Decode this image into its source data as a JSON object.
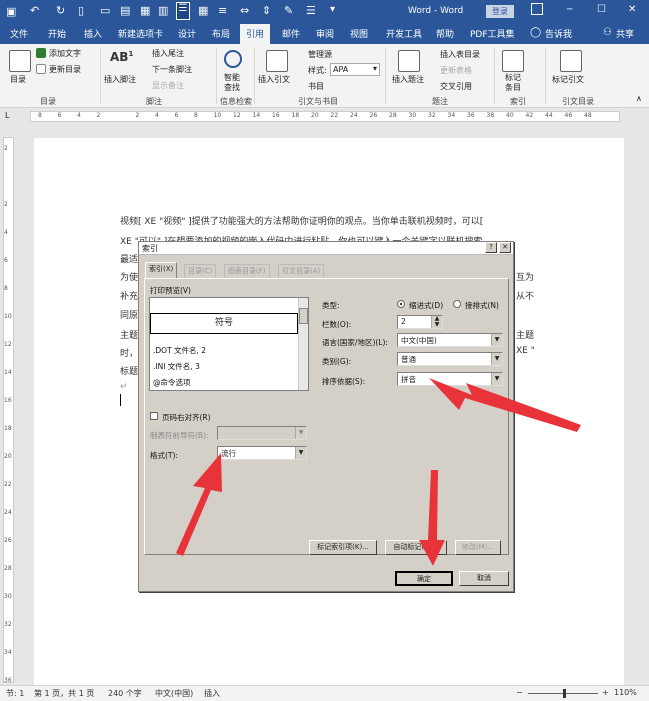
{
  "titlebar": {
    "title": "Word - Word",
    "login": "登录",
    "controls": [
      "─",
      "☐",
      "✕"
    ]
  },
  "tabs": [
    "文件",
    "开始",
    "插入",
    "新建选项卡",
    "设计",
    "布局",
    "引用",
    "邮件",
    "审阅",
    "视图",
    "开发工具",
    "帮助",
    "PDF工具集"
  ],
  "tabs_active": "引用",
  "tell_me": "告诉我",
  "share": "共享",
  "ribbon": {
    "toc_btn": "目录",
    "add_text": "添加文字",
    "update_toc": "更新目录",
    "insert_footnote": "插入脚注",
    "insert_endnote": "插入尾注",
    "next_footnote": "下一条脚注",
    "show_notes": "显示备注",
    "smart_lookup_1": "智能",
    "smart_lookup_2": "查找",
    "insert_citation": "插入引文",
    "manage_sources": "管理源",
    "style_label": "样式:",
    "style_value": "APA",
    "bibliography": "书目",
    "insert_caption": "插入题注",
    "insert_table_figures": "插入表目录",
    "update_table": "更新表格",
    "cross_ref": "交叉引用",
    "mark_entry_1": "标记",
    "mark_entry_2": "条目",
    "mark_citation": "标记引文",
    "groups": [
      "目录",
      "脚注",
      "信息检索",
      "引文与书目",
      "题注",
      "索引",
      "引文目录"
    ]
  },
  "document": {
    "line1": "视频[ XE \"视频\" ]提供了功能强大的方法帮助你证明你的观点。当你单击联机视频时，可以[",
    "line2": "XE \"可以\" ]在想要添加的视频的嵌入代码中进行粘贴。你也可以键入一个关键字以联机搜索",
    "line3": "最适",
    "line4_left": "为使",
    "line4_right": "互为",
    "line5_left": "补充",
    "line5_right": "从不",
    "line6_left": "同原",
    "line7_left": "主题",
    "line7_right": "主题",
    "line8_left": "时，",
    "line8_right": "XE \"",
    "line9_left": "标题",
    "mark": "↵"
  },
  "dialog": {
    "title": "索引",
    "help": "?",
    "close": "✕",
    "tabs": [
      "索引(X)",
      "目录(C)",
      "图表目录(F)",
      "引文目录(A)"
    ],
    "print_preview": "打印预览(V)",
    "preview_heading": "符号",
    "preview_lines": [
      ".DOT 文件名, 2",
      ".INI 文件名, 3",
      "@命令选项"
    ],
    "type_label": "类型:",
    "radio_indented": "缩进式(D)",
    "radio_runin": "接排式(N)",
    "columns_label": "栏数(O):",
    "columns_value": "2",
    "language_label": "语言(国家/地区)(L):",
    "language_value": "中文(中国)",
    "category_label": "类别(G):",
    "category_value": "普通",
    "sort_label": "排序依据(S):",
    "sort_value": "拼音",
    "right_align": "页码右对齐(R)",
    "tab_leader": "制表符前导符(B):",
    "format_label": "格式(T):",
    "format_value": "流行",
    "mark_entry_btn": "标记索引项(K)...",
    "automark_btn": "自动标记(U)...",
    "modify_btn": "修改(M)...",
    "ok_btn": "确定",
    "cancel_btn": "取消"
  },
  "status": {
    "page": "节: 1",
    "pages": "第 1 页，共 1 页",
    "words": "240 个字",
    "lang": "中文(中国)",
    "insert": "插入",
    "zoom": "110%"
  },
  "ruler_numbers": [
    "8",
    "6",
    "4",
    "2",
    "",
    "2",
    "4",
    "6",
    "8",
    "10",
    "12",
    "14",
    "16",
    "18",
    "20",
    "22",
    "24",
    "26",
    "28",
    "30",
    "32",
    "34",
    "36",
    "38",
    "40",
    "42",
    "44",
    "46",
    "48"
  ],
  "vruler_numbers": [
    "2",
    "",
    "2",
    "4",
    "6",
    "8",
    "10",
    "12",
    "14",
    "16",
    "18",
    "20",
    "22",
    "24",
    "26",
    "28",
    "30",
    "32",
    "34",
    "36"
  ],
  "colors": {
    "brand": "#2b579a",
    "arrow": "#e8333a",
    "dialog_bg": "#d4d0c8"
  }
}
